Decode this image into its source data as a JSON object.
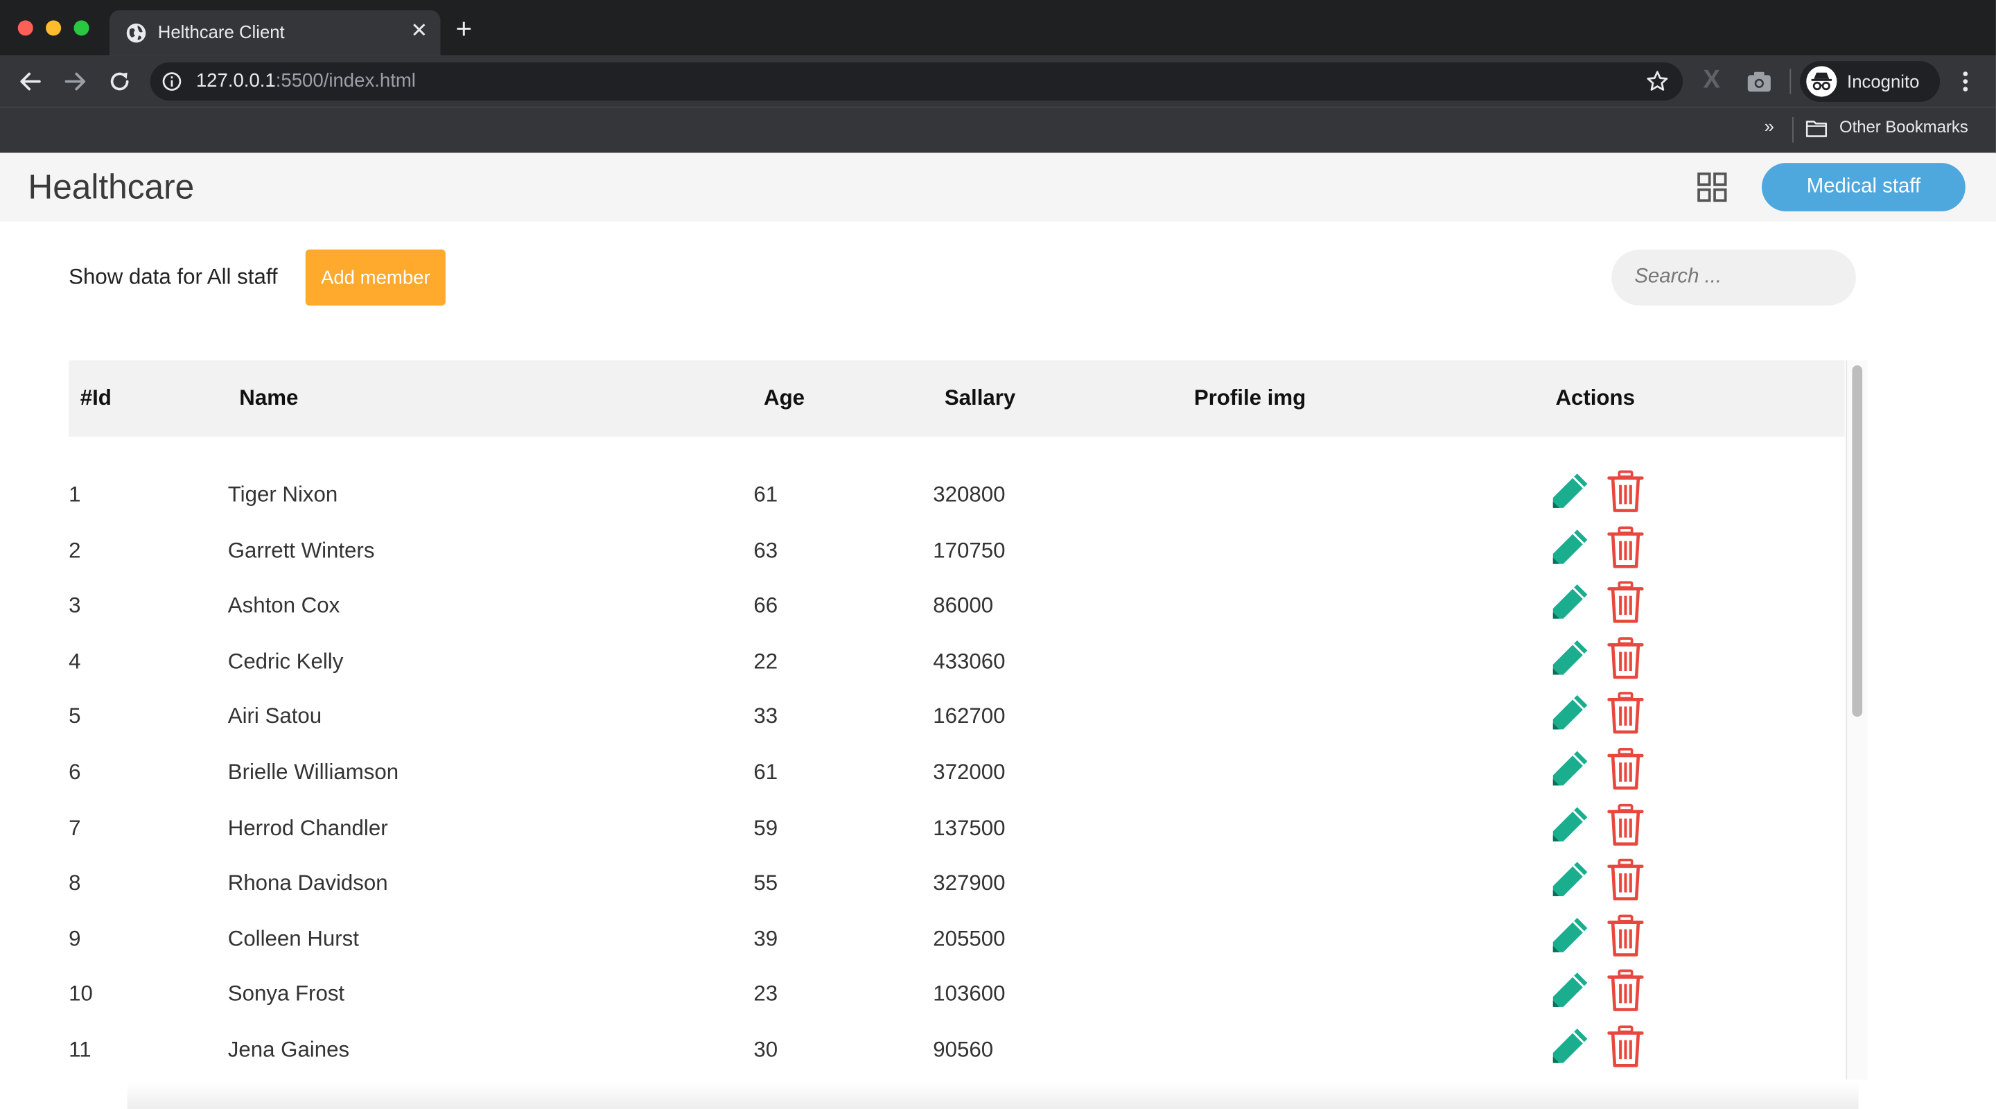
{
  "browser": {
    "tab_title": "Helthcare Client",
    "tab_close": "✕",
    "new_tab": "+",
    "url_host": "127.0.0.1",
    "url_rest": ":5500/index.html",
    "extension_x": "X",
    "profile_label": "Incognito",
    "bookmarks_chevron": "»",
    "bookmarks_folder_label": "Other Bookmarks"
  },
  "header": {
    "brand": "Healthcare",
    "staff_button_label": "Medical staff",
    "accent_color": "#4ea8de"
  },
  "toolbar": {
    "show_label": "Show data for All staff",
    "add_button_label": "Add member",
    "add_button_color": "#ffa92d",
    "search_placeholder": "Search ..."
  },
  "table": {
    "columns": [
      "#Id",
      "Name",
      "Age",
      "Sallary",
      "Profile img",
      "Actions"
    ],
    "rows": [
      {
        "id": "1",
        "name": "Tiger Nixon",
        "age": "61",
        "salary": "320800"
      },
      {
        "id": "2",
        "name": "Garrett Winters",
        "age": "63",
        "salary": "170750"
      },
      {
        "id": "3",
        "name": "Ashton Cox",
        "age": "66",
        "salary": "86000"
      },
      {
        "id": "4",
        "name": "Cedric Kelly",
        "age": "22",
        "salary": "433060"
      },
      {
        "id": "5",
        "name": "Airi Satou",
        "age": "33",
        "salary": "162700"
      },
      {
        "id": "6",
        "name": "Brielle Williamson",
        "age": "61",
        "salary": "372000"
      },
      {
        "id": "7",
        "name": "Herrod Chandler",
        "age": "59",
        "salary": "137500"
      },
      {
        "id": "8",
        "name": "Rhona Davidson",
        "age": "55",
        "salary": "327900"
      },
      {
        "id": "9",
        "name": "Colleen Hurst",
        "age": "39",
        "salary": "205500"
      },
      {
        "id": "10",
        "name": "Sonya Frost",
        "age": "23",
        "salary": "103600"
      },
      {
        "id": "11",
        "name": "Jena Gaines",
        "age": "30",
        "salary": "90560"
      }
    ],
    "edit_icon": "pencil-icon",
    "delete_icon": "trash-icon",
    "edit_color": "#1aae8f",
    "delete_color": "#e8473d"
  }
}
